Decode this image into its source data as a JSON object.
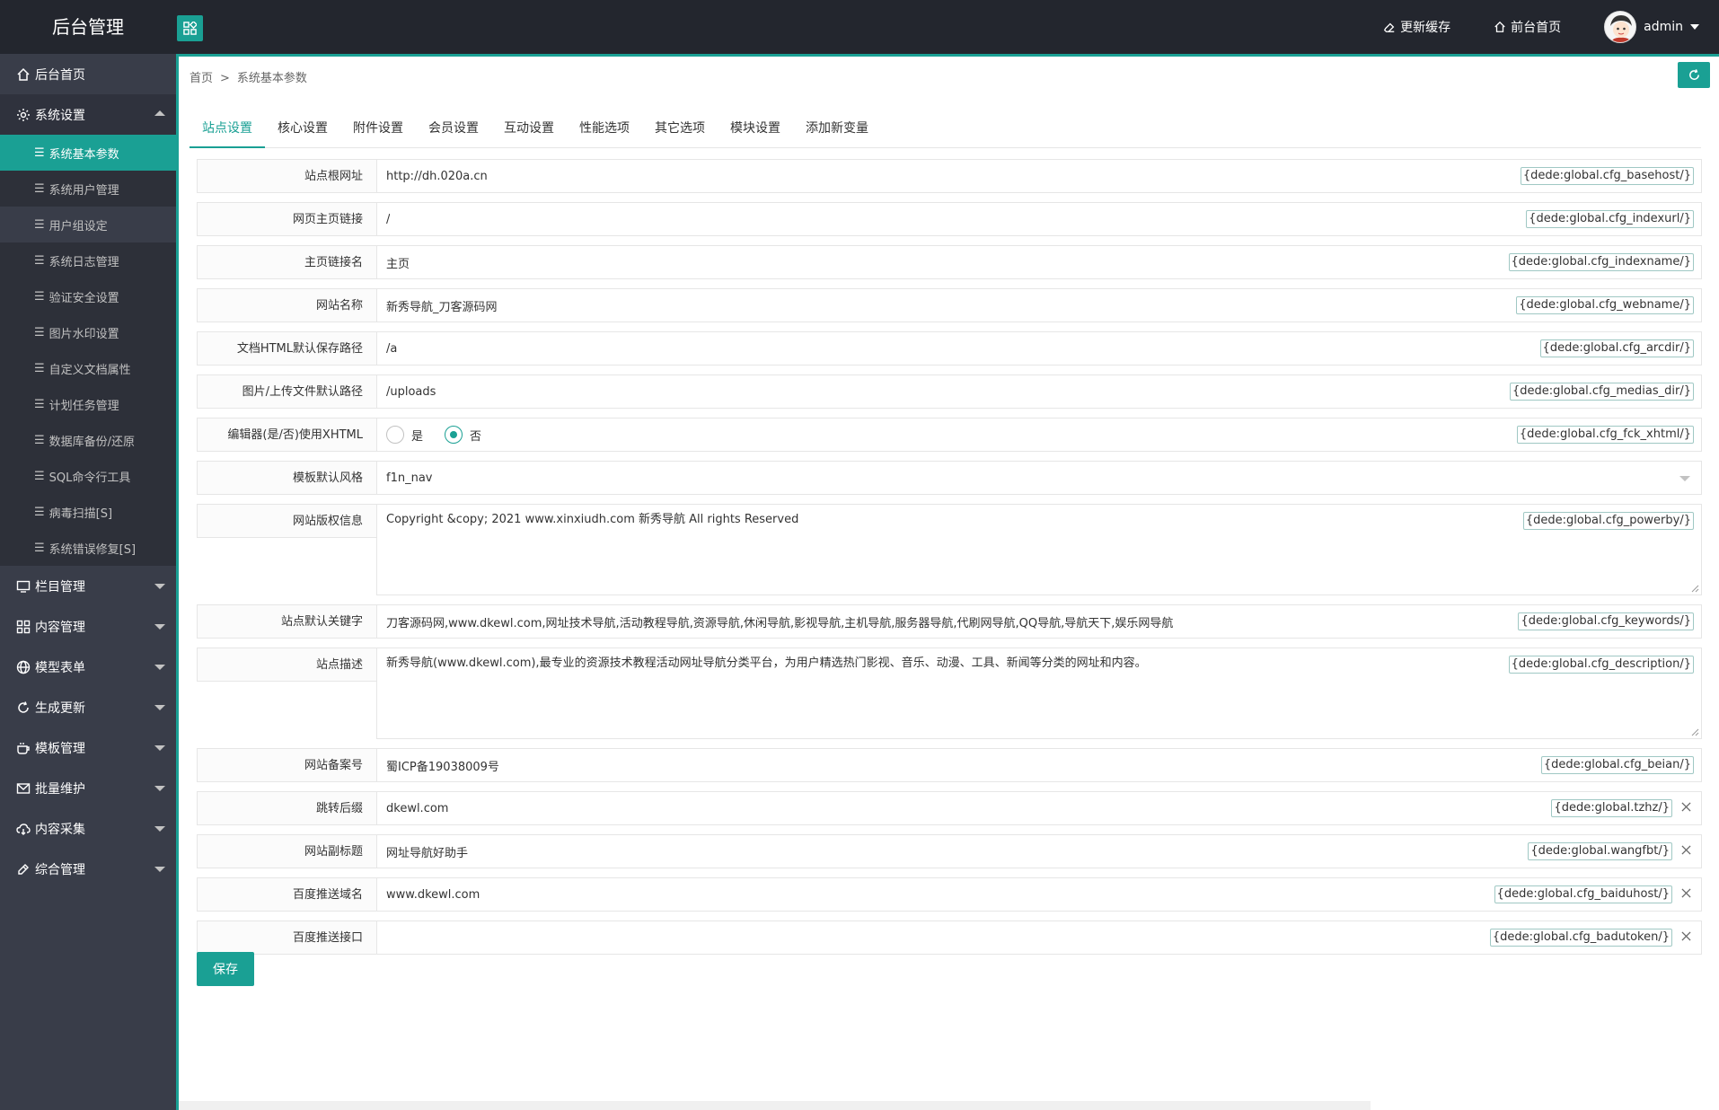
{
  "header": {
    "brand": "后台管理",
    "refresh_cache": "更新缓存",
    "frontend_home": "前台首页",
    "username": "admin"
  },
  "sidebar": {
    "groups": [
      {
        "label": "后台首页",
        "icon": "home-icon"
      },
      {
        "label": "系统设置",
        "icon": "gear-icon"
      },
      {
        "label": "栏目管理",
        "icon": "monitor-icon"
      },
      {
        "label": "内容管理",
        "icon": "grid-icon"
      },
      {
        "label": "模型表单",
        "icon": "globe-icon"
      },
      {
        "label": "生成更新",
        "icon": "refresh-icon"
      },
      {
        "label": "模板管理",
        "icon": "cup-icon"
      },
      {
        "label": "批量维护",
        "icon": "mail-icon"
      },
      {
        "label": "内容采集",
        "icon": "cloud-icon"
      },
      {
        "label": "综合管理",
        "icon": "brush-icon"
      }
    ],
    "system_items": [
      "系统基本参数",
      "系统用户管理",
      "用户组设定",
      "系统日志管理",
      "验证安全设置",
      "图片水印设置",
      "自定义文档属性",
      "计划任务管理",
      "数据库备份/还原",
      "SQL命令行工具",
      "病毒扫描[S]",
      "系统错误修复[S]"
    ]
  },
  "breadcrumb": {
    "home": "首页",
    "sep": ">",
    "current": "系统基本参数"
  },
  "tabs": [
    "站点设置",
    "核心设置",
    "附件设置",
    "会员设置",
    "互动设置",
    "性能选项",
    "其它选项",
    "模块设置",
    "添加新变量"
  ],
  "form": {
    "rows": [
      {
        "label": "站点根网址",
        "value": "http://dh.020a.cn",
        "tag": "{dede:global.cfg_basehost/}"
      },
      {
        "label": "网页主页链接",
        "value": "/",
        "tag": "{dede:global.cfg_indexurl/}"
      },
      {
        "label": "主页链接名",
        "value": "主页",
        "tag": "{dede:global.cfg_indexname/}"
      },
      {
        "label": "网站名称",
        "value": "新秀导航_刀客源码网",
        "tag": "{dede:global.cfg_webname/}"
      },
      {
        "label": "文档HTML默认保存路径",
        "value": "/a",
        "tag": "{dede:global.cfg_arcdir/}"
      },
      {
        "label": "图片/上传文件默认路径",
        "value": "/uploads",
        "tag": "{dede:global.cfg_medias_dir/}"
      }
    ],
    "xhtml": {
      "label": "编辑器(是/否)使用XHTML",
      "yes": "是",
      "no": "否",
      "tag": "{dede:global.cfg_fck_xhtml/}"
    },
    "template": {
      "label": "模板默认风格",
      "value": "f1n_nav"
    },
    "copyright": {
      "label": "网站版权信息",
      "value": "Copyright &copy; 2021 www.xinxiudh.com  新秀导航 All rights Reserved",
      "tag": "{dede:global.cfg_powerby/}"
    },
    "keywords": {
      "label": "站点默认关键字",
      "value": "刀客源码网,www.dkewl.com,网址技术导航,活动教程导航,资源导航,休闲导航,影视导航,主机导航,服务器导航,代刷网导航,QQ导航,导航天下,娱乐网导航",
      "tag": "{dede:global.cfg_keywords/}"
    },
    "description": {
      "label": "站点描述",
      "value": "新秀导航(www.dkewl.com),最专业的资源技术教程活动网址导航分类平台，为用户精选热门影视、音乐、动漫、工具、新闻等分类的网址和内容。",
      "tag": "{dede:global.cfg_description/}"
    },
    "rows2": [
      {
        "label": "网站备案号",
        "value": "蜀ICP备19038009号",
        "tag": "{dede:global.cfg_beian/}"
      },
      {
        "label": "跳转后缀",
        "value": "dkewl.com",
        "tag": "{dede:global.tzhz/}"
      },
      {
        "label": "网站副标题",
        "value": "网址导航好助手",
        "tag": "{dede:global.wangfbt/}"
      },
      {
        "label": "百度推送域名",
        "value": "www.dkewl.com",
        "tag": "{dede:global.cfg_baiduhost/}"
      },
      {
        "label": "百度推送接口",
        "value": "",
        "tag": "{dede:global.cfg_badutoken/}"
      }
    ],
    "save": "保存"
  },
  "colors": {
    "accent": "#1aa094",
    "header_bg": "#23262e",
    "sidebar_bg": "#393d49"
  }
}
